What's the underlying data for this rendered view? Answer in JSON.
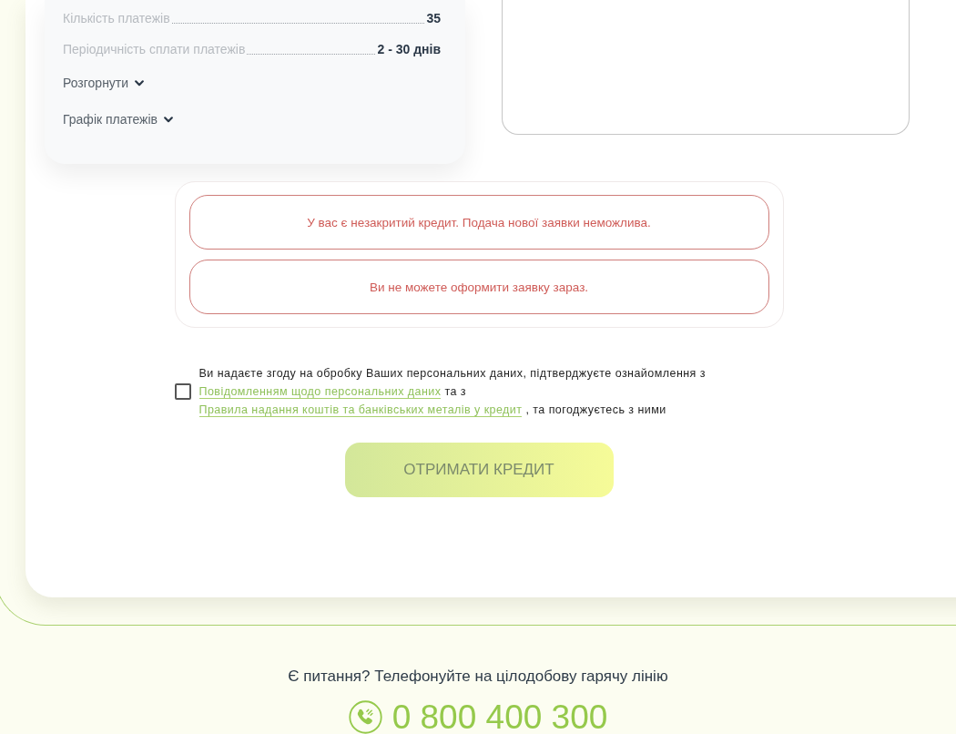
{
  "loan_summary": {
    "rows": [
      {
        "label": "Кількість платежів",
        "value": "35"
      },
      {
        "label": "Періодичність сплати платежів",
        "value": "2 - 30 днів"
      }
    ],
    "toggles": [
      {
        "label": "Розгорнути",
        "expanded": false
      },
      {
        "label": "Графік платежів",
        "expanded": false
      }
    ]
  },
  "alerts": [
    {
      "text": "У вас є незакритий кредит. Подача нової заявки неможлива."
    },
    {
      "text": "Ви не можете оформити заявку зараз."
    }
  ],
  "consent": {
    "checked": false,
    "parts": [
      {
        "kind": "text",
        "text": "Ви надаєте згоду на обробку Ваших персональних даних, підтверджуєте ознайомлення з"
      },
      {
        "kind": "link",
        "text": "Повідомленням щодо персональних даних"
      },
      {
        "kind": "text",
        "text": "та з"
      },
      {
        "kind": "link",
        "text": "Правила надання коштів та банківських металів у кредит"
      },
      {
        "kind": "text",
        "text": ", та погоджуєтесь з ними"
      }
    ]
  },
  "submit_button": {
    "label": "ОТРИМАТИ КРЕДИТ",
    "disabled": true
  },
  "footer": {
    "hotline_text": "Є питання? Телефонуйте на цілодобову гарячу лінію",
    "phone": "0 800 400 300"
  }
}
